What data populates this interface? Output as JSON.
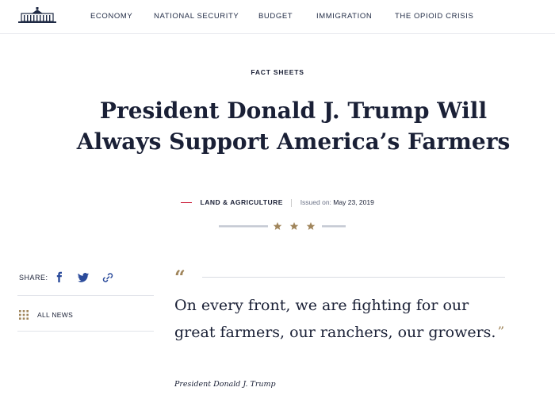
{
  "nav": {
    "items": [
      "ECONOMY",
      "NATIONAL SECURITY",
      "BUDGET",
      "IMMIGRATION",
      "THE OPIOID CRISIS"
    ]
  },
  "article": {
    "eyebrow": "FACT SHEETS",
    "title": "President Donald J. Trump Will Always Support America’s Farmers",
    "category": "LAND & AGRICULTURE",
    "issued_label": "Issued on:",
    "issued_date": "May 23, 2019"
  },
  "sidebar": {
    "share_label": "SHARE:",
    "share_icons": [
      "facebook-icon",
      "twitter-icon",
      "link-icon"
    ],
    "all_news_label": "ALL NEWS"
  },
  "quote": {
    "open_mark": "“",
    "text": "On every front, we are fighting for our great farmers, our ranchers, our growers.",
    "close_mark": "”",
    "attribution": "President Donald J. Trump"
  },
  "colors": {
    "navy": "#1a2036",
    "accent_red": "#c8102e",
    "gold": "#a0855b",
    "rule": "#e1e4ea"
  }
}
